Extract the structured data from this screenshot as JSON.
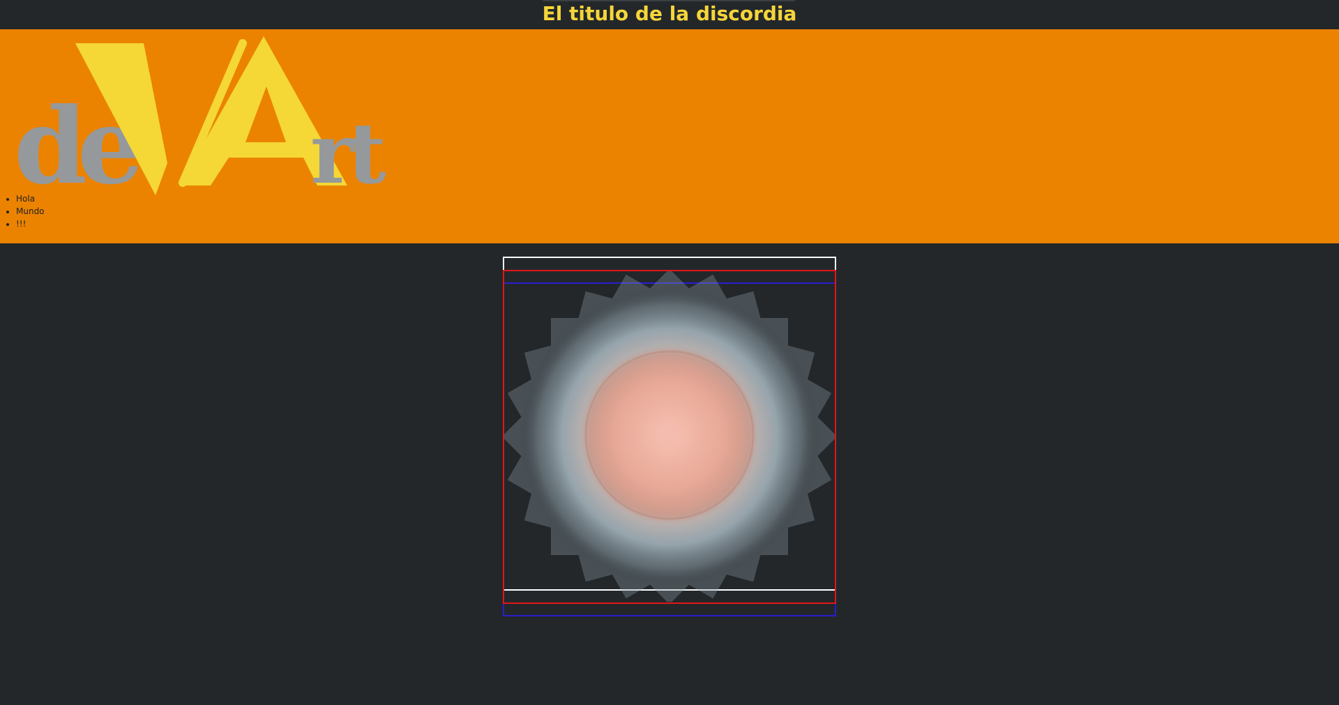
{
  "header": {
    "title": "El titulo de la discordia"
  },
  "banner": {
    "logo_text": "deVArt",
    "colors": {
      "background": "#eb8300",
      "logo_yellow": "#f5d835",
      "logo_gray": "#95999c"
    }
  },
  "nav": {
    "items": [
      {
        "label": "Hola"
      },
      {
        "label": "Mundo"
      },
      {
        "label": "!!!"
      }
    ]
  },
  "canvas": {
    "frame_colors": [
      "#ffffff",
      "#e0161a",
      "#2a1fd0"
    ],
    "art_colors": {
      "center": "#f0b0a0",
      "halo": "#a9b9c2"
    }
  },
  "colors": {
    "page_background": "#23272a",
    "title_color": "#f5d53a"
  }
}
